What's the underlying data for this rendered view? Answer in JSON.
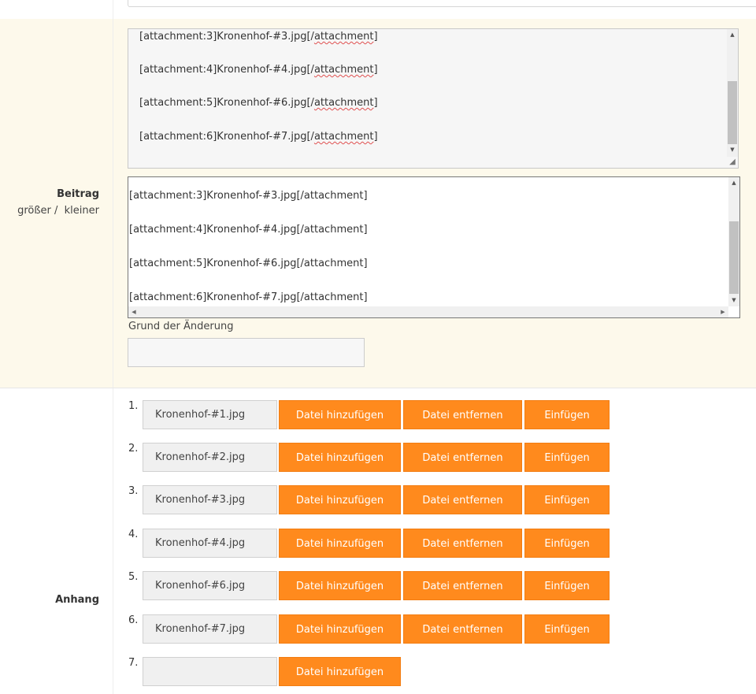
{
  "beitrag": {
    "title": "Beitrag",
    "size_larger": "größer /",
    "size_smaller": "kleiner",
    "editor_lines": [
      {
        "prefix": "[attachment:3]Kronenhof-#3.jpg[/",
        "tag": "attachment",
        "suffix": "]"
      },
      {
        "prefix": "[attachment:4]Kronenhof-#4.jpg[/",
        "tag": "attachment",
        "suffix": "]"
      },
      {
        "prefix": "[attachment:5]Kronenhof-#6.jpg[/",
        "tag": "attachment",
        "suffix": "]"
      },
      {
        "prefix": "[attachment:6]Kronenhof-#7.jpg[/",
        "tag": "attachment",
        "suffix": "]"
      }
    ],
    "preview_lines": [
      "[attachment:3]Kronenhof-#3.jpg[/attachment]",
      "[attachment:4]Kronenhof-#4.jpg[/attachment]",
      "[attachment:5]Kronenhof-#6.jpg[/attachment]",
      "[attachment:6]Kronenhof-#7.jpg[/attachment]"
    ],
    "reason_label": "Grund der Änderung",
    "reason_value": ""
  },
  "anhang": {
    "title": "Anhang",
    "add_label": "Datei hinzufügen",
    "remove_label": "Datei entfernen",
    "insert_label": "Einfügen",
    "items": [
      {
        "num": "1.",
        "file": "Kronenhof-#1.jpg"
      },
      {
        "num": "2.",
        "file": "Kronenhof-#2.jpg"
      },
      {
        "num": "3.",
        "file": "Kronenhof-#3.jpg"
      },
      {
        "num": "4.",
        "file": "Kronenhof-#4.jpg"
      },
      {
        "num": "5.",
        "file": "Kronenhof-#6.jpg"
      },
      {
        "num": "6.",
        "file": "Kronenhof-#7.jpg"
      },
      {
        "num": "7.",
        "file": ""
      }
    ]
  },
  "colors": {
    "button": "#ff8a1d",
    "row_highlight": "#fdf9eb"
  },
  "icons": {
    "scroll_up": "scroll-up-arrow-icon",
    "scroll_down": "scroll-down-arrow-icon",
    "scroll_left": "scroll-left-arrow-icon",
    "scroll_right": "scroll-right-arrow-icon",
    "resize": "resize-grip-icon"
  }
}
